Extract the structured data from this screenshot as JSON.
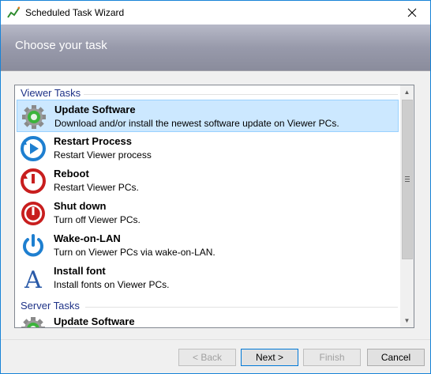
{
  "window": {
    "title": "Scheduled Task Wizard"
  },
  "header": {
    "title": "Choose your task"
  },
  "task_list": {
    "groups": [
      {
        "label": "Viewer Tasks",
        "items": [
          {
            "name": "Update Software",
            "desc": "Download and/or install the newest software update on Viewer PCs.",
            "icon": "gear-update-icon",
            "selected": true
          },
          {
            "name": "Restart Process",
            "desc": "Restart Viewer process",
            "icon": "restart-process-icon"
          },
          {
            "name": "Reboot",
            "desc": "Restart Viewer PCs.",
            "icon": "reboot-icon"
          },
          {
            "name": "Shut down",
            "desc": "Turn off Viewer PCs.",
            "icon": "shutdown-icon"
          },
          {
            "name": "Wake-on-LAN",
            "desc": "Turn on Viewer PCs via wake-on-LAN.",
            "icon": "power-icon"
          },
          {
            "name": "Install font",
            "desc": "Install fonts on Viewer PCs.",
            "icon": "font-icon"
          }
        ]
      },
      {
        "label": "Server Tasks",
        "items": [
          {
            "name": "Update Software",
            "desc": "",
            "icon": "gear-update-icon"
          }
        ]
      }
    ]
  },
  "buttons": {
    "back": "< Back",
    "next": "Next >",
    "finish": "Finish",
    "cancel": "Cancel"
  },
  "colors": {
    "accent_border": "#1883d7",
    "selection_bg": "#cce8ff",
    "group_header": "#1e3287",
    "header_band": "#989aab"
  }
}
